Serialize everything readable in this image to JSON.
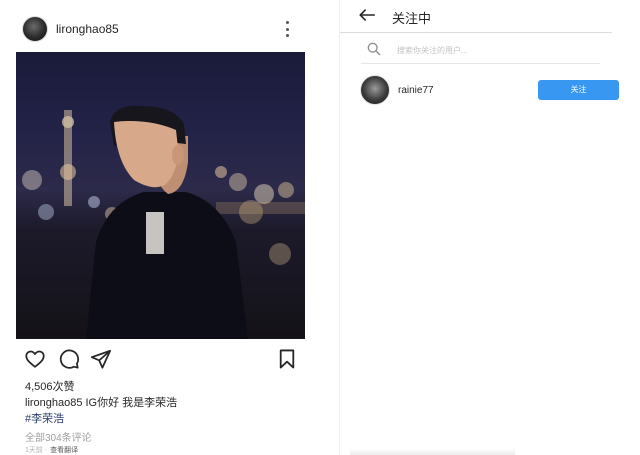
{
  "post": {
    "username": "lironghao85",
    "likes": "4,506次赞",
    "caption_user": "lironghao85",
    "caption_text": "IG你好 我是李荣浩",
    "hashtag": "#李荣浩",
    "view_comments": "全部304条评论",
    "time_ago": "1天前 ·",
    "translate": "查看翻译"
  },
  "following": {
    "title": "关注中",
    "search_placeholder": "搜索你关注的用户...",
    "user": "rainie77",
    "follow_label": "关注"
  },
  "colors": {
    "follow_button": "#3897f0",
    "hashtag": "#263a6b",
    "text": "#262626",
    "muted": "#a0a0a0"
  },
  "icons": [
    "more-icon",
    "heart-icon",
    "comment-icon",
    "share-icon",
    "bookmark-icon",
    "back-arrow-icon",
    "search-icon"
  ]
}
